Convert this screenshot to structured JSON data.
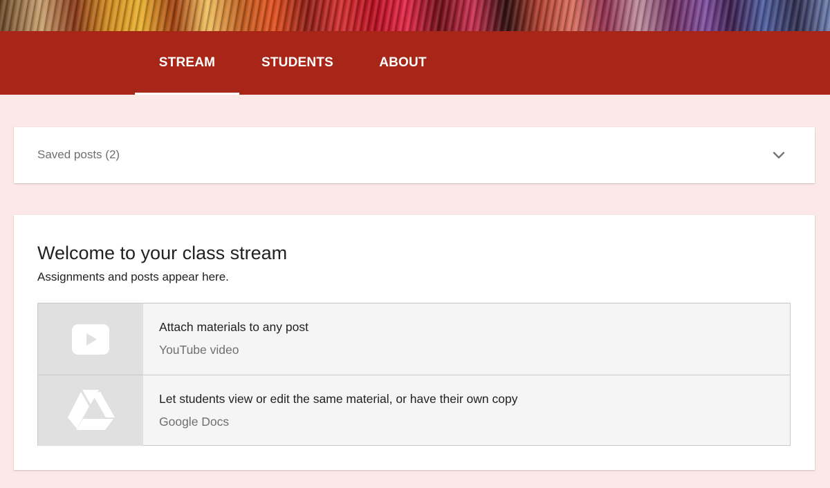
{
  "nav": {
    "tabs": [
      {
        "label": "STREAM",
        "active": true
      },
      {
        "label": "STUDENTS",
        "active": false
      },
      {
        "label": "ABOUT",
        "active": false
      }
    ]
  },
  "saved_posts": {
    "label": "Saved posts (2)",
    "toggle_icon": "chevron-down-icon"
  },
  "welcome": {
    "title": "Welcome to your class stream",
    "subtitle": "Assignments and posts appear here.",
    "materials": [
      {
        "icon": "youtube-icon",
        "title": "Attach materials to any post",
        "subtitle": "YouTube video"
      },
      {
        "icon": "google-drive-icon",
        "title": "Let students view or edit the same material, or have their own copy",
        "subtitle": "Google Docs"
      }
    ]
  },
  "colors": {
    "nav_background": "#a72617",
    "page_background": "#fce8e6",
    "card_background": "#ffffff",
    "icon_cell_background": "#e0e0e0"
  }
}
